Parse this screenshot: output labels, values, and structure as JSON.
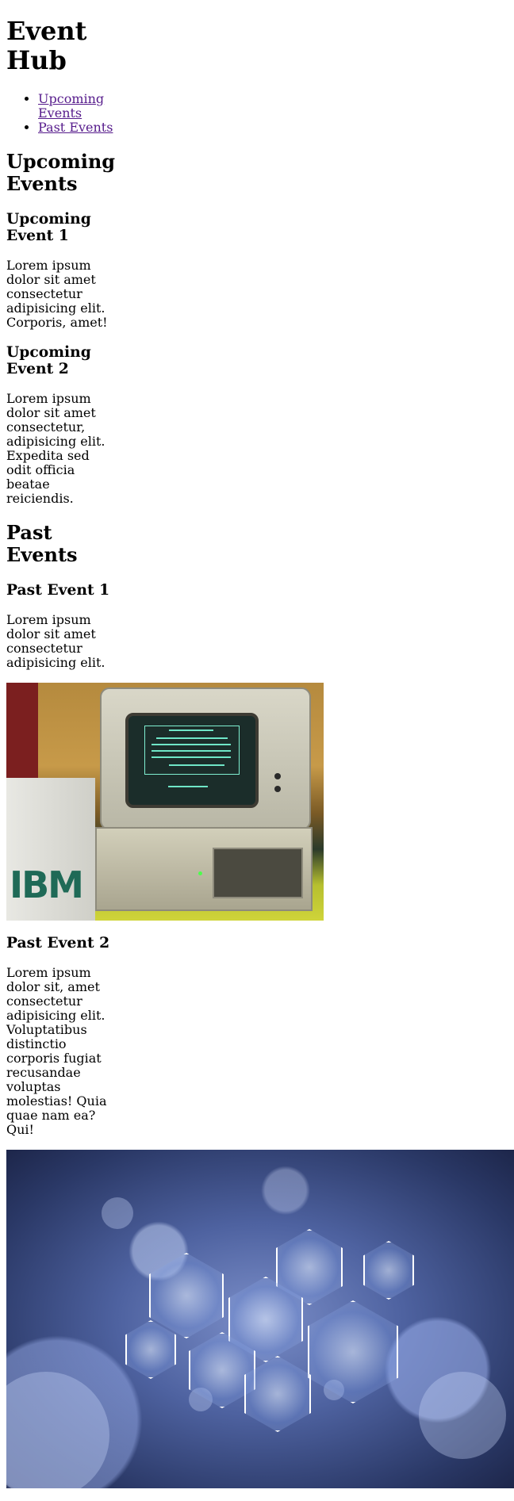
{
  "site": {
    "title": "Event Hub"
  },
  "nav": {
    "items": [
      {
        "label": "Upcoming Events"
      },
      {
        "label": "Past Events"
      }
    ]
  },
  "upcoming": {
    "heading": "Upcoming Events",
    "events": [
      {
        "title": "Upcoming Event 1",
        "description": "Lorem ipsum dolor sit amet consectetur adipisicing elit. Corporis, amet!"
      },
      {
        "title": "Upcoming Event 2",
        "description": "Lorem ipsum dolor sit amet consectetur, adipisicing elit. Expedita sed odit officia beatae reiciendis."
      }
    ]
  },
  "past": {
    "heading": "Past Events",
    "events": [
      {
        "title": "Past Event 1",
        "description": "Lorem ipsum dolor sit amet consectetur adipisicing elit.",
        "image": {
          "subject": "vintage IBM computer",
          "icon": "image-icon"
        }
      },
      {
        "title": "Past Event 2",
        "description": "Lorem ipsum dolor sit, amet consectetur adipisicing elit. Voluptatibus distinctio corporis fugiat recusandae voluptas molestias! Quia quae nam ea? Qui!",
        "image": {
          "subject": "abstract blue hexagon network",
          "icon": "image-icon"
        }
      }
    ]
  },
  "colors": {
    "link": "#551a8b",
    "text": "#000000",
    "background": "#ffffff"
  }
}
